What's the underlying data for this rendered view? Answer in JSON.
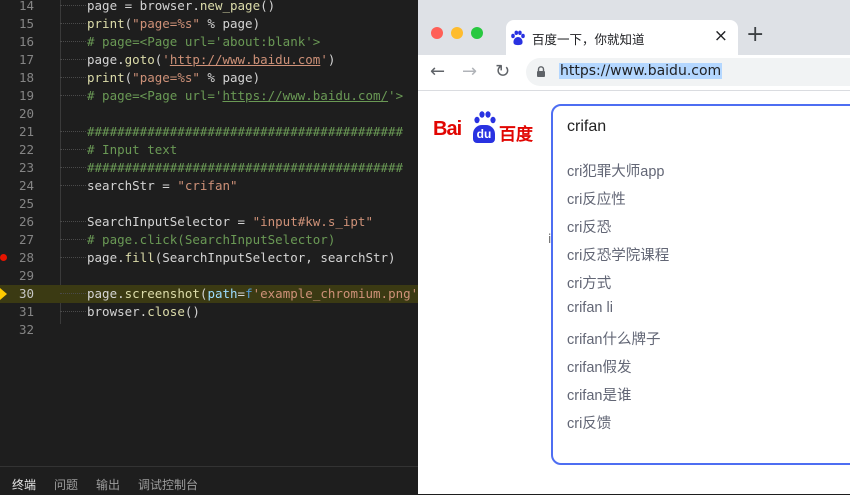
{
  "editor": {
    "lines": [
      {
        "n": "14",
        "html": "page = browser.<span class=\"kw\">new_page</span>()"
      },
      {
        "n": "15",
        "html": "<span class=\"kw\">print</span>(<span class=\"str\">\"page=%s\"</span> % page)"
      },
      {
        "n": "16",
        "html": "<span class=\"cmt\"># page=&lt;Page url='about:blank'&gt;</span>"
      },
      {
        "n": "17",
        "html": "page.<span class=\"kw\">goto</span>(<span class=\"str\">'</span><span class=\"url\">http://www.baidu.com</span><span class=\"str\">'</span>)"
      },
      {
        "n": "18",
        "html": "<span class=\"kw\">print</span>(<span class=\"str\">\"page=%s\"</span> % page)"
      },
      {
        "n": "19",
        "html": "<span class=\"cmt\"># page=&lt;Page url='<u>https://www.baidu.com/</u>'&gt;</span>"
      },
      {
        "n": "20",
        "html": ""
      },
      {
        "n": "21",
        "html": "<span class=\"cmt\">##########################################</span>"
      },
      {
        "n": "22",
        "html": "<span class=\"cmt\"># Input text</span>"
      },
      {
        "n": "23",
        "html": "<span class=\"cmt\">##########################################</span>"
      },
      {
        "n": "24",
        "html": "searchStr = <span class=\"str\">\"crifan\"</span>"
      },
      {
        "n": "25",
        "html": ""
      },
      {
        "n": "26",
        "html": "SearchInputSelector = <span class=\"str\">\"input#kw.s_ipt\"</span>"
      },
      {
        "n": "27",
        "html": "<span class=\"cmt\"># page.click(SearchInputSelector)</span>"
      },
      {
        "n": "28",
        "html": "page.<span class=\"kw\">fill</span>(SearchInputSelector, searchStr)"
      },
      {
        "n": "29",
        "html": ""
      },
      {
        "n": "30",
        "html": "page.<span class=\"kw\">screenshot</span>(<span class=\"var\">path</span>=<span class=\"op\">f</span><span class=\"str\">'example_chromium.png'</span>)"
      },
      {
        "n": "31",
        "html": "browser.<span class=\"kw\">close</span>()"
      },
      {
        "n": "32",
        "html": ""
      }
    ],
    "breakpoint_line": "28",
    "current_line": "30"
  },
  "panel": {
    "tabs": [
      "终端",
      "问题",
      "输出",
      "调试控制台"
    ]
  },
  "browser": {
    "tab_title": "百度一下，你就知道",
    "tab_close": "×",
    "new_tab": "+",
    "back": "←",
    "forward": "→",
    "reload": "↻",
    "url": "https://www.baidu.com",
    "logo_bai": "Bai",
    "logo_du": "du",
    "logo_cn": "百度",
    "stray_char": "i",
    "search_value": "crifan",
    "suggestions": [
      "cri犯罪大师app",
      "cri反应性",
      "cri反恐",
      "cri反恐学院课程",
      "cri方式",
      "crifan li",
      "crifan什么牌子",
      "crifan假发",
      "crifan是谁",
      "cri反馈"
    ],
    "colors": {
      "accent": "#4e6ef2",
      "brand_red": "#e10602",
      "brand_blue": "#2932e1"
    }
  }
}
